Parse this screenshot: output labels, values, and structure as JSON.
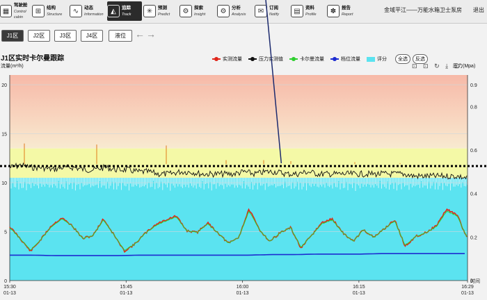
{
  "nav": {
    "items": [
      {
        "cn": "驾驶舱",
        "en": "Control cabin",
        "icon": "▦"
      },
      {
        "cn": "结构",
        "en": "Structure",
        "icon": "⊞"
      },
      {
        "cn": "动态",
        "en": "Information",
        "icon": "∿"
      },
      {
        "cn": "追踪",
        "en": "Track",
        "icon": "◭"
      },
      {
        "cn": "预测",
        "en": "Predict",
        "icon": "✳"
      },
      {
        "cn": "探索",
        "en": "Insight",
        "icon": "⚙"
      },
      {
        "cn": "分析",
        "en": "Analysis",
        "icon": "⚙"
      },
      {
        "cn": "订阅",
        "en": "Notify",
        "icon": "✉"
      },
      {
        "cn": "资料",
        "en": "Profile",
        "icon": "▤"
      },
      {
        "cn": "报告",
        "en": "Report",
        "icon": "✽"
      }
    ],
    "active_index": 3,
    "station": "金域平江——万能水箱卫士泵房",
    "exit": "退出"
  },
  "zones": {
    "tabs": [
      "J1区",
      "J2区",
      "J3区",
      "J4区",
      "液位"
    ],
    "active_index": 0,
    "prev_icon": "arrow-left-icon",
    "next_icon": "arrow-right-icon"
  },
  "chart_header": {
    "title": "J1区实时卡尔曼跟踪",
    "unit_left": "流量(m³/h)",
    "unit_right": "压力(Mpa)",
    "legend": [
      {
        "label": "实测流量",
        "color": "#e0261b"
      },
      {
        "label": "压力实测值",
        "color": "#111111"
      },
      {
        "label": "卡尔曼流量",
        "color": "#2fcf2f"
      },
      {
        "label": "档位流量",
        "color": "#1c2bd1"
      },
      {
        "label": "评分",
        "color": "#5be3f0"
      }
    ],
    "btn_all": "全选",
    "btn_invert": "反选",
    "tools": "⊡ ⊡ ↻ ⤓ ⊡"
  },
  "chart_data": {
    "type": "line",
    "x_ticks": [
      {
        "time": "15:30",
        "date": "01-13"
      },
      {
        "time": "15:45",
        "date": "01-13"
      },
      {
        "time": "16:00",
        "date": "01-13"
      },
      {
        "time": "16:15",
        "date": "01-13"
      },
      {
        "time": "16:29",
        "date": "01-13"
      }
    ],
    "x_axis_end_label": "时间",
    "x_range": [
      "15:30",
      "16:29"
    ],
    "y_left": {
      "ticks": [
        0,
        5,
        10,
        15,
        20
      ],
      "range": [
        0,
        21
      ]
    },
    "y_right": {
      "ticks": [
        0,
        0.2,
        0.4,
        0.6,
        0.8,
        0.9
      ],
      "range": [
        0,
        0.945
      ]
    },
    "threshold": {
      "y": 11.7,
      "color": "#000000",
      "style": "dotted"
    },
    "score_level": 10.5,
    "bands": [
      {
        "from": 13.5,
        "to": 21,
        "top_color": "#f7b9a8",
        "bottom_color": "#f8ead0"
      },
      {
        "from": 10.5,
        "to": 13.5,
        "color": "#f4f9a6"
      }
    ],
    "series": [
      {
        "name": "压力实测值",
        "axis": "right",
        "color": "#111111",
        "values": [
          0.52,
          0.53,
          0.52,
          0.52,
          0.51,
          0.52,
          0.52,
          0.51,
          0.51,
          0.52,
          0.51,
          0.51,
          0.5,
          0.5,
          0.49,
          0.49,
          0.5,
          0.5,
          0.49,
          0.49,
          0.49,
          0.49,
          0.5,
          0.49,
          0.5,
          0.5,
          0.49,
          0.49,
          0.5,
          0.49,
          0.49,
          0.49,
          0.49,
          0.49,
          0.49,
          0.49,
          0.49,
          0.49,
          0.48,
          0.48,
          0.48,
          0.48,
          0.48,
          0.47
        ]
      },
      {
        "name": "实测流量",
        "axis": "left",
        "color": "#e0261b",
        "values": [
          5.5,
          4.3,
          3.0,
          4.2,
          5.6,
          6.4,
          5.6,
          4.3,
          4.6,
          6.3,
          4.7,
          3.0,
          3.7,
          4.8,
          5.7,
          6.2,
          6.6,
          5.1,
          4.9,
          5.9,
          4.9,
          3.8,
          4.4,
          7.3,
          5.2,
          4.0,
          4.9,
          5.4,
          3.3,
          4.6,
          5.9,
          6.3,
          4.9,
          4.0,
          5.2,
          4.4,
          5.3,
          6.2,
          3.5,
          4.5,
          4.9,
          5.6,
          7.3,
          6.7,
          4.2
        ]
      },
      {
        "name": "卡尔曼流量",
        "axis": "left",
        "color": "#2fcf2f",
        "values": [
          5.4,
          4.3,
          3.1,
          4.2,
          5.5,
          6.3,
          5.6,
          4.3,
          4.6,
          6.2,
          4.7,
          3.1,
          3.7,
          4.8,
          5.6,
          6.1,
          6.5,
          5.1,
          4.9,
          5.8,
          4.9,
          3.8,
          4.4,
          7.1,
          5.2,
          4.0,
          4.9,
          5.4,
          3.4,
          4.6,
          5.8,
          6.2,
          4.9,
          4.0,
          5.2,
          4.4,
          5.3,
          6.1,
          3.6,
          4.5,
          4.9,
          5.5,
          7.1,
          6.6,
          4.3
        ]
      },
      {
        "name": "档位流量",
        "axis": "left",
        "color": "#1c2bd1",
        "values": [
          2.6,
          2.6,
          2.55,
          2.55,
          2.55,
          2.55,
          2.6,
          2.6,
          2.6,
          2.6,
          2.6,
          2.6,
          2.65,
          2.65,
          2.7,
          2.7,
          2.7,
          2.75,
          2.75,
          2.75,
          2.75,
          2.75
        ]
      }
    ],
    "annotation_line": {
      "from_time": "16:03",
      "to_time": "16:05"
    }
  }
}
